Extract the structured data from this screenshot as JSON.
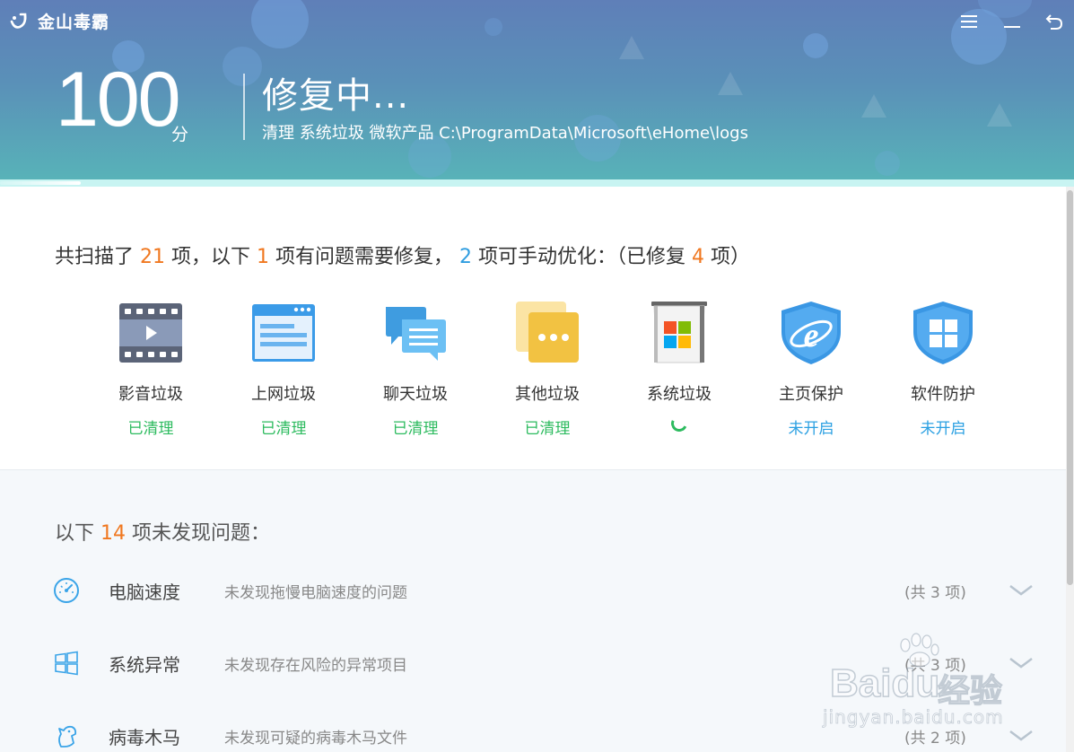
{
  "app": {
    "title": "金山毒霸"
  },
  "window_controls": {
    "menu_icon": "menu-icon",
    "minimize_icon": "minimize-icon",
    "back_icon": "back-icon"
  },
  "header": {
    "score": "100",
    "score_unit": "分",
    "status_title": "修复中...",
    "status_path": "清理 系统垃圾 微软产品 C:\\ProgramData\\Microsoft\\eHome\\logs",
    "progress": 0.075
  },
  "summary": {
    "p1": "共扫描了 ",
    "scanned": "21",
    "p2": " 项，以下 ",
    "problems": "1",
    "p3": " 项有问题需要修复， ",
    "optimizable": "2",
    "p4": " 项可手动优化：（已修复 ",
    "fixed": "4",
    "p5": " 项）"
  },
  "categories": [
    {
      "name": "影音垃圾",
      "status": "已清理",
      "icon": "video-junk-icon"
    },
    {
      "name": "上网垃圾",
      "status": "已清理",
      "icon": "browser-junk-icon"
    },
    {
      "name": "聊天垃圾",
      "status": "已清理",
      "icon": "chat-junk-icon"
    },
    {
      "name": "其他垃圾",
      "status": "已清理",
      "icon": "other-junk-icon"
    },
    {
      "name": "系统垃圾",
      "status": "",
      "icon": "system-trash-icon"
    },
    {
      "name": "主页保护",
      "status": "未开启",
      "icon": "ie-shield-icon"
    },
    {
      "name": "软件防护",
      "status": "未开启",
      "icon": "windows-shield-icon"
    }
  ],
  "no_issue": {
    "p1": "以下 ",
    "count": "14",
    "p2": " 项未发现问题：",
    "rows": [
      {
        "name": "电脑速度",
        "desc": "未发现拖慢电脑速度的问题",
        "count": "(共 3 项)",
        "icon": "speedometer-icon"
      },
      {
        "name": "系统异常",
        "desc": "未发现存在风险的异常项目",
        "count": "(共 3 项)",
        "icon": "windows-logo-icon"
      },
      {
        "name": "病毒木马",
        "desc": "未发现可疑的病毒木马文件",
        "count": "(共 2 项)",
        "icon": "trojan-horse-icon"
      }
    ]
  },
  "watermark": {
    "brand": "Baidu",
    "cn": "经验",
    "url": "jingyan.baidu.com"
  },
  "colors": {
    "orange": "#f07820",
    "blue": "#2f9de0",
    "green": "#2dbb5f"
  }
}
